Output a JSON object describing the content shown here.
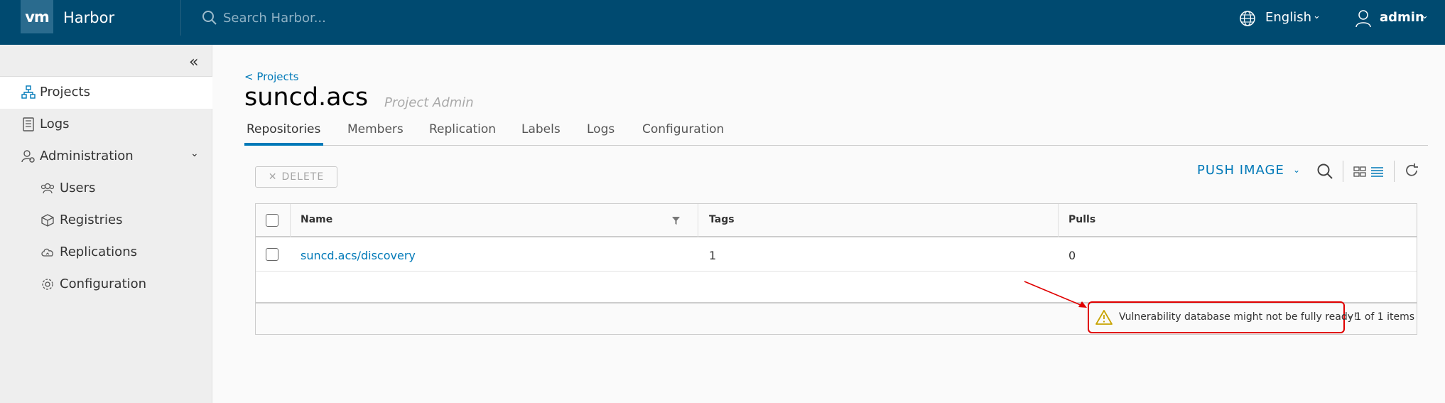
{
  "header": {
    "logo": "vm",
    "brand": "Harbor",
    "search_placeholder": "Search Harbor...",
    "language": "English",
    "user": "admin",
    "bg_color": "#004a70"
  },
  "sidebar": {
    "items": [
      {
        "label": "Projects",
        "icon": "projects-icon",
        "active": true
      },
      {
        "label": "Logs",
        "icon": "logs-icon"
      },
      {
        "label": "Administration",
        "icon": "administration-icon",
        "expanded": true
      },
      {
        "label": "Users",
        "icon": "users-icon"
      },
      {
        "label": "Registries",
        "icon": "registries-icon"
      },
      {
        "label": "Replications",
        "icon": "replications-icon"
      },
      {
        "label": "Configuration",
        "icon": "configuration-icon"
      }
    ]
  },
  "main": {
    "breadcrumb": "< Projects",
    "title": "suncd.acs",
    "role": "Project Admin",
    "tabs": [
      "Repositories",
      "Members",
      "Replication",
      "Labels",
      "Logs",
      "Configuration"
    ],
    "active_tab": "Repositories",
    "delete_label": "DELETE",
    "push_image_label": "PUSH IMAGE",
    "accent_color": "#0079b8"
  },
  "table": {
    "columns": [
      "Name",
      "Tags",
      "Pulls"
    ],
    "rows": [
      {
        "name": "suncd.acs/discovery",
        "tags": "1",
        "pulls": "0"
      }
    ],
    "warning": "Vulnerability database might not be fully ready!",
    "pagination": "- 1 of 1 items"
  }
}
